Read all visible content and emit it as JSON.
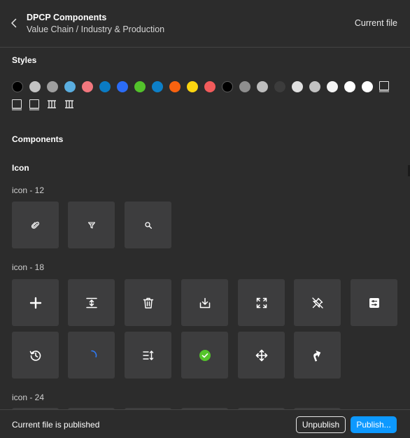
{
  "header": {
    "title": "DPCP Components",
    "subtitle": "Value Chain / Industry & Production",
    "current_file_label": "Current file"
  },
  "styles": {
    "heading": "Styles",
    "color_swatches": [
      "#000000",
      "#c4c4c4",
      "#9e9e9e",
      "#5aaee0",
      "#f2777e",
      "#0a7bc4",
      "#2b6cf6",
      "#53c22b",
      "#0d7fc7",
      "#f9620f",
      "#fbd510",
      "#f25b5b",
      "#000000",
      "#8f8f8f",
      "#bdbdbd",
      "#3c3c3c",
      "#e0e0e0",
      "#c2c2c2",
      "#f5f5f5",
      "#ffffff",
      "#ffffff"
    ],
    "text_style_count": 3,
    "grid_style_count": 2
  },
  "components": {
    "heading": "Components",
    "group_title": "Icon",
    "sets": [
      {
        "label": "icon - 12",
        "icons": [
          "paperclip-icon",
          "filter-icon",
          "search-icon"
        ]
      },
      {
        "label": "icon - 18",
        "icons": [
          "plus-icon",
          "expand-vertical-icon",
          "trash-icon",
          "download-icon",
          "fullscreen-icon",
          "pin-off-icon",
          "sliders-icon",
          "history-icon",
          "spinner-icon",
          "sort-icon",
          "check-circle-icon",
          "move-icon",
          "turn-up-right-icon"
        ]
      },
      {
        "label": "icon - 24",
        "icons": []
      }
    ],
    "check_color": "#54c42b",
    "spinner_color": "#2f7bf6"
  },
  "footer": {
    "status": "Current file is published",
    "unpublish_label": "Unpublish",
    "publish_label": "Publish...",
    "publish_color": "#0d99ff"
  }
}
